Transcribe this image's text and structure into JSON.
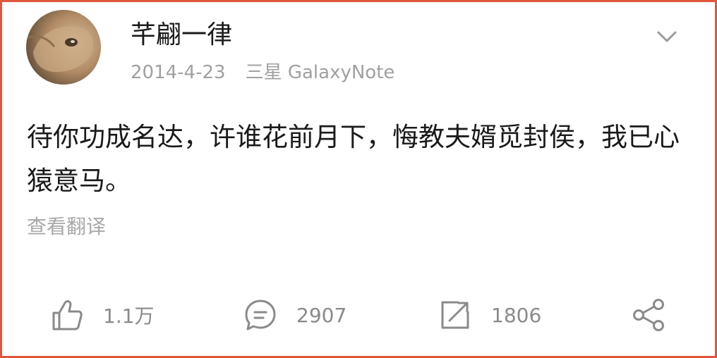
{
  "post": {
    "author": "芊翩一律",
    "date": "2014-4-23",
    "device": "三星 GalaxyNote",
    "text": "待你功成名达，许谁花前月下，悔教夫婿觅封侯，我已心猿意马。",
    "translate_label": "查看翻译"
  },
  "actions": {
    "likes": "1.1万",
    "comments": "2907",
    "reposts": "1806"
  },
  "icons": {
    "more": "chevron-down-icon",
    "like": "thumbs-up-icon",
    "comment": "comment-bubble-icon",
    "repost": "repost-arrow-icon",
    "share": "share-icon"
  },
  "colors": {
    "frame": "#e0563b",
    "text": "#1a1a1a",
    "muted": "#a0a0a0"
  }
}
